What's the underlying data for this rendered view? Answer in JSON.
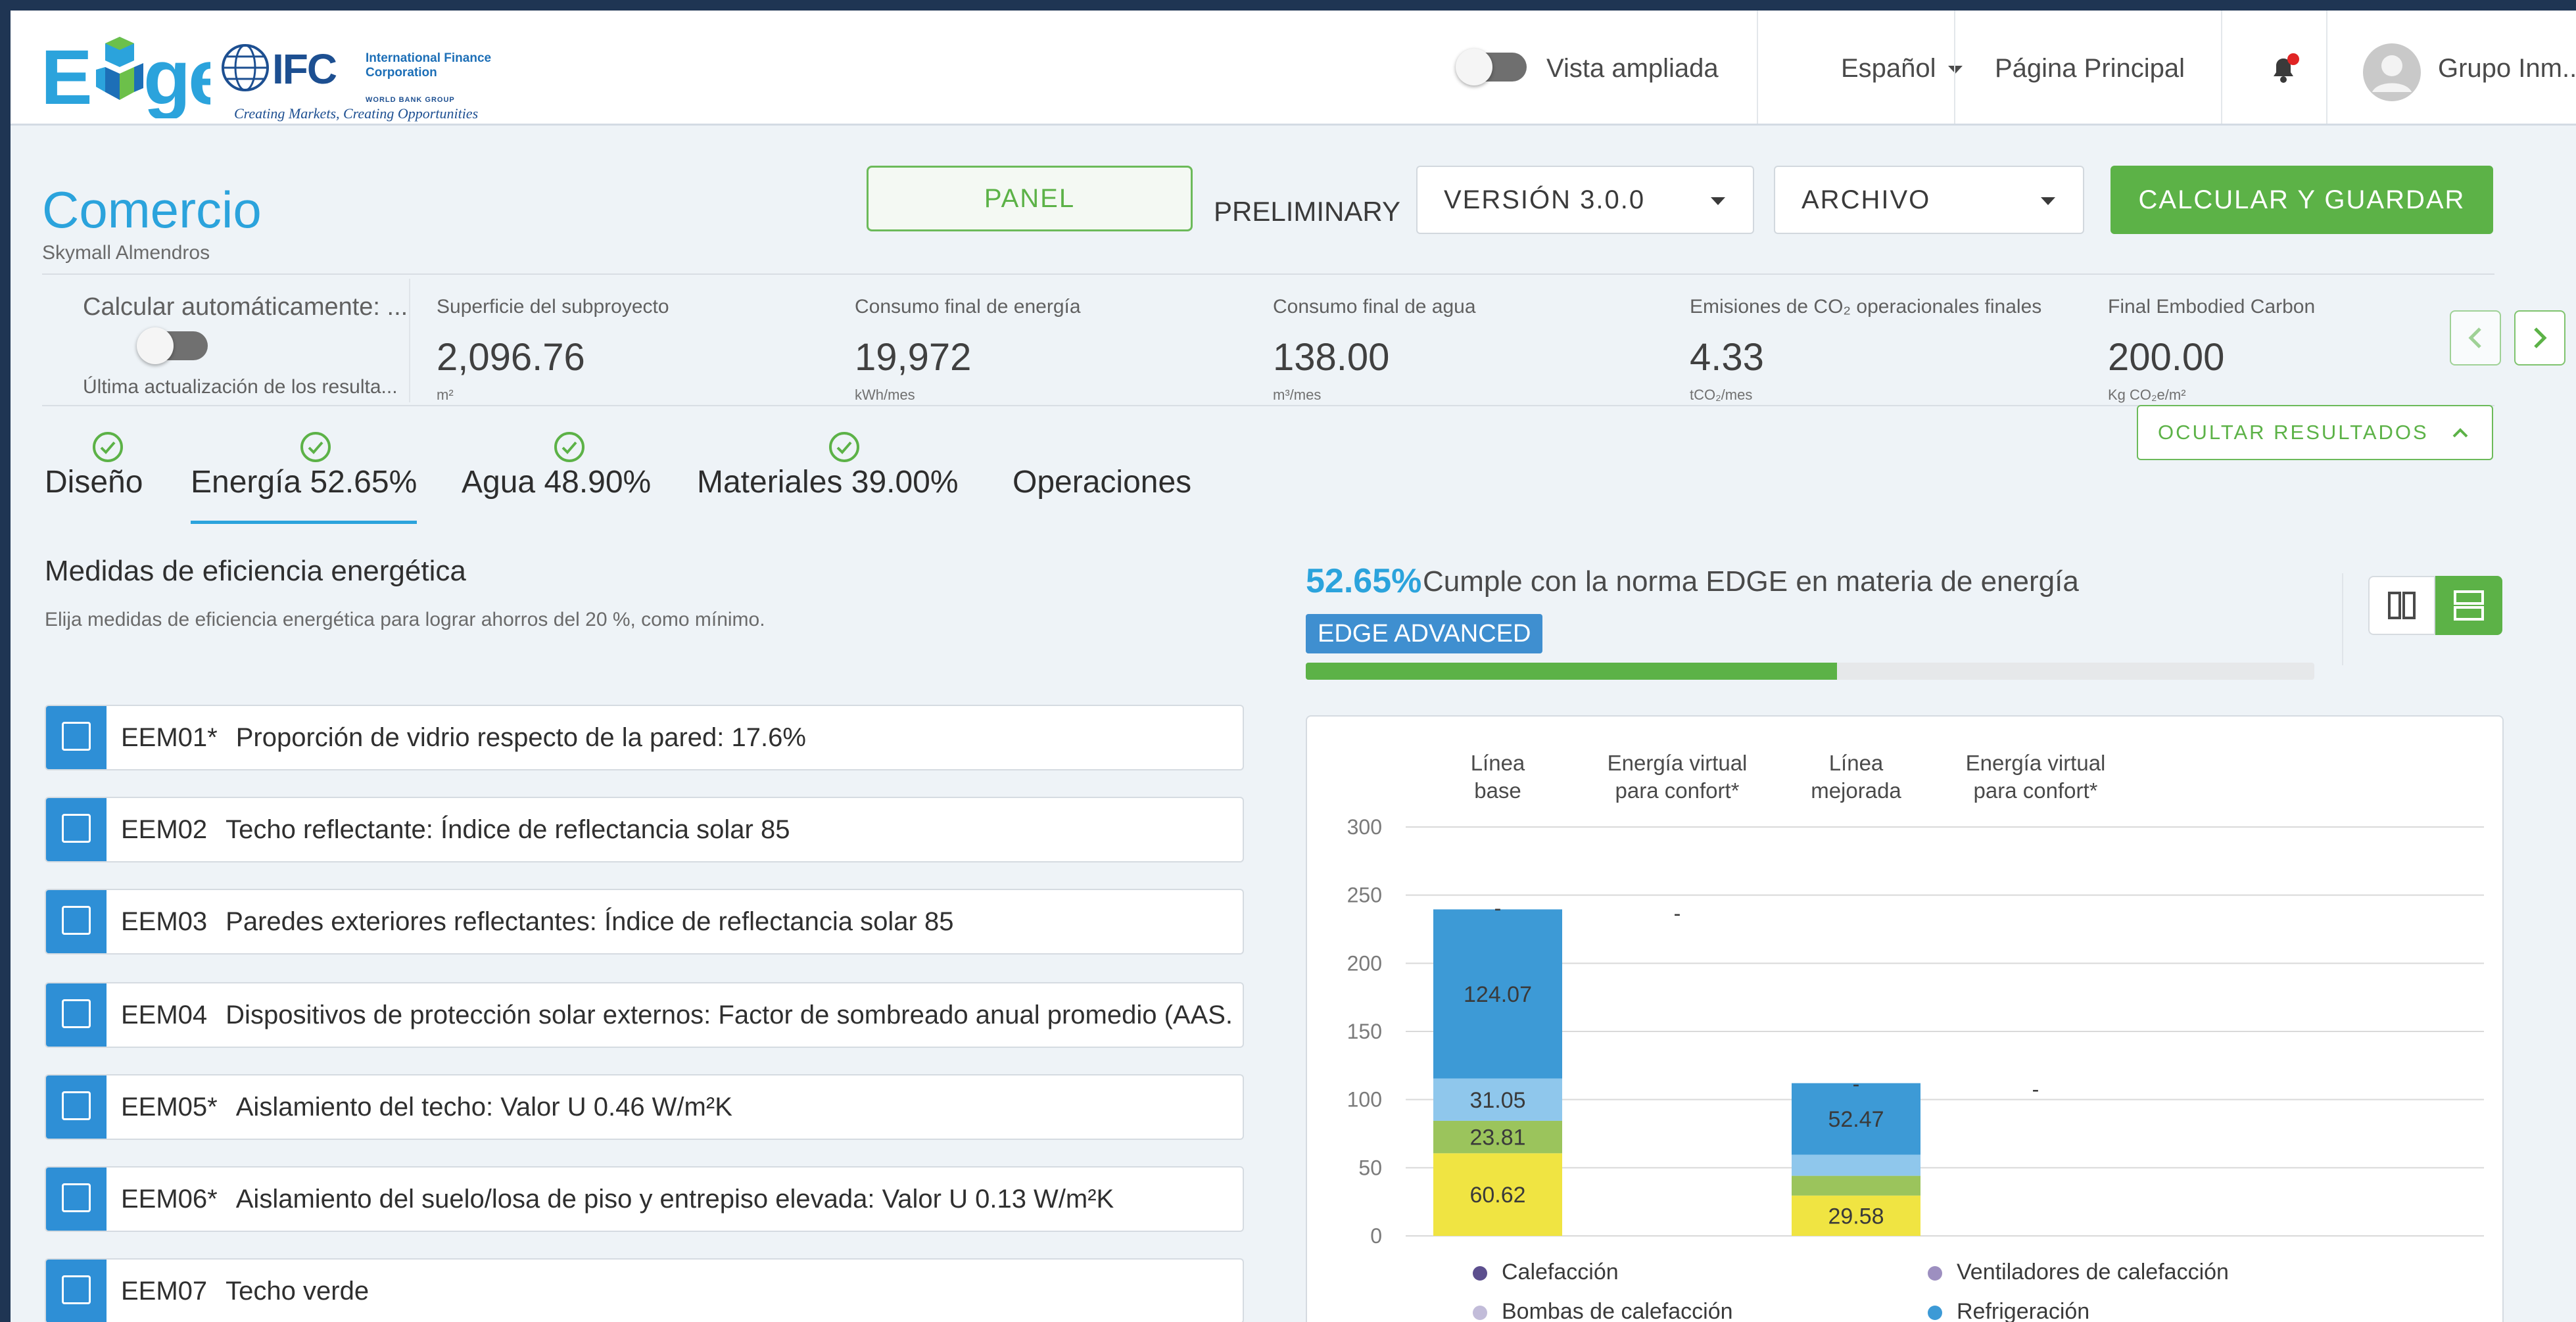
{
  "topbar": {
    "logo_text": "Edge",
    "ifc_letters": "IFC",
    "ifc_name": "International Finance Corporation",
    "ifc_group": "WORLD BANK GROUP",
    "ifc_tagline": "Creating Markets, Creating Opportunities",
    "vista_label": "Vista ampliada",
    "language": "Español",
    "home": "Página Principal",
    "user": "Grupo Inm..."
  },
  "header": {
    "title": "Comercio",
    "subtitle": "Skymall Almendros",
    "panel_label": "PANEL",
    "preliminary": "PRELIMINARY",
    "version": "VERSIÓN 3.0.0",
    "archivo": "ARCHIVO",
    "calc_label": "CALCULAR Y GUARDAR"
  },
  "results": {
    "auto_calc_label": "Calcular automáticamente: ...",
    "last_update": "Última actualización de los resulta...",
    "items": [
      {
        "label": "Superficie del subproyecto",
        "value": "2,096.76",
        "unit": "m²"
      },
      {
        "label": "Consumo final de energía",
        "value": "19,972",
        "unit": "kWh/mes"
      },
      {
        "label": "Consumo final de agua",
        "value": "138.00",
        "unit": "m³/mes"
      },
      {
        "label": "Emisiones de CO₂ operacionales finales",
        "value": "4.33",
        "unit": "tCO₂/mes"
      },
      {
        "label": "Final Embodied Carbon",
        "value": "200.00",
        "unit": "Kg CO₂e/m²"
      }
    ],
    "hide_label": "OCULTAR RESULTADOS"
  },
  "tabs": [
    {
      "label": "Diseño",
      "checked": true
    },
    {
      "label": "Energía 52.65%",
      "checked": true,
      "active": true
    },
    {
      "label": "Agua 48.90%",
      "checked": true
    },
    {
      "label": "Materiales 39.00%",
      "checked": true
    },
    {
      "label": "Operaciones",
      "checked": false
    }
  ],
  "energy": {
    "title": "Medidas de eficiencia energética",
    "subtitle": "Elija medidas de eficiencia energética para lograr ahorros del 20 %, como mínimo.",
    "measures": [
      {
        "code": "EEM01*",
        "text": "Proporción de vidrio respecto de la pared: 17.6%"
      },
      {
        "code": "EEM02",
        "text": "Techo reflectante: Índice de reflectancia solar 85"
      },
      {
        "code": "EEM03",
        "text": "Paredes exteriores reflectantes: Índice de reflectancia solar 85"
      },
      {
        "code": "EEM04",
        "text": "Dispositivos de protección solar externos: Factor de sombreado anual promedio (AAS..."
      },
      {
        "code": "EEM05*",
        "text": "Aislamiento del techo: Valor U 0.46 W/m²K"
      },
      {
        "code": "EEM06*",
        "text": "Aislamiento del suelo/losa de piso y entrepiso elevada: Valor U 0.13 W/m²K"
      },
      {
        "code": "EEM07",
        "text": "Techo verde"
      }
    ]
  },
  "compliance": {
    "percent": "52.65%",
    "text": "Cumple con la norma EDGE en materia de energía",
    "badge": "EDGE ADVANCED",
    "progress": 0.5265
  },
  "colors": {
    "accent": "#2ba3dc",
    "green": "#5cb247",
    "checkbox_blue": "#2e8fd6"
  },
  "chart_data": {
    "type": "bar",
    "stacked": true,
    "categories": [
      "Línea base",
      "Energía virtual para confort*",
      "Línea mejorada",
      "Energía virtual para confort*"
    ],
    "ylim": [
      0,
      300
    ],
    "yticks": [
      0,
      50,
      100,
      150,
      200,
      250,
      300
    ],
    "grid": true,
    "legend_position": "bottom",
    "series": [
      {
        "name": "",
        "color": "#f0e442",
        "values": [
          60.62,
          null,
          29.58,
          null
        ],
        "labels": [
          "60.62",
          "",
          "29.58",
          ""
        ]
      },
      {
        "name": "",
        "color": "#9bc45c",
        "values": [
          23.81,
          null,
          14.5,
          null
        ],
        "labels": [
          "23.81",
          "",
          "",
          ""
        ]
      },
      {
        "name": "",
        "color": "#8fc7ec",
        "values": [
          31.05,
          null,
          15.5,
          null
        ],
        "labels": [
          "31.05",
          "",
          "",
          ""
        ]
      },
      {
        "name": "Refrigeración",
        "color": "#3d9ad6",
        "values": [
          124.07,
          null,
          52.47,
          null
        ],
        "labels": [
          "124.07",
          "",
          "52.47",
          ""
        ]
      }
    ],
    "top_markers": [
      {
        "category": 0,
        "label": "-",
        "value": 240
      },
      {
        "category": 1,
        "label": "-",
        "value": 236
      },
      {
        "category": 2,
        "label": "-",
        "value": 111
      },
      {
        "category": 3,
        "label": "-",
        "value": 107
      }
    ],
    "legend": [
      {
        "name": "Calefacción",
        "color": "#5c4f8e"
      },
      {
        "name": "Ventiladores de calefacción",
        "color": "#9d8fc0"
      },
      {
        "name": "Bombas de calefacción",
        "color": "#c2bcd9"
      },
      {
        "name": "Refrigeración",
        "color": "#3d9ad6"
      }
    ]
  }
}
